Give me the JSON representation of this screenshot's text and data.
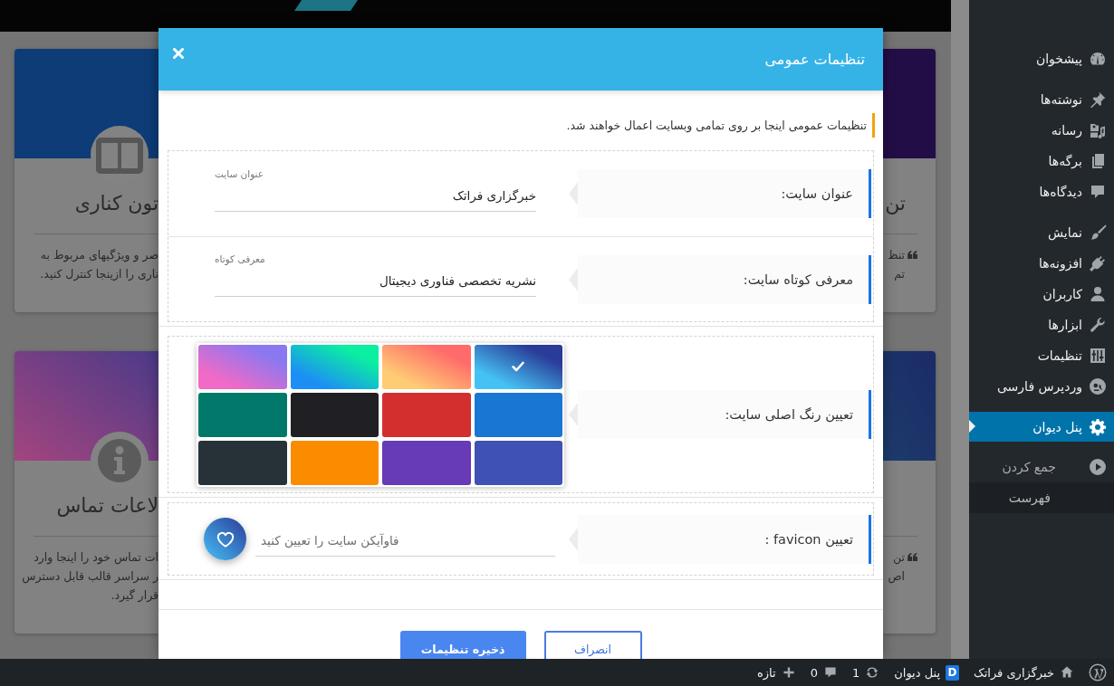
{
  "background_page": {
    "left_cards": [
      {
        "title": "تون کناری",
        "lines": [
          "صر و ویژگیهای مربوط به",
          "ناری را ازینجا کنترل کنید."
        ]
      },
      {
        "title": "لاعات تماس",
        "lines": [
          "ات تماس خود را اینجا وارد",
          "ر سراسر قالب قابل دسترس",
          "قرار گیرد."
        ]
      }
    ],
    "right_cards": [
      {
        "title": "تن",
        "lines": [
          "تنظ",
          "تم"
        ]
      },
      {
        "lines": [
          "تن",
          "اص"
        ]
      }
    ]
  },
  "dialog": {
    "title": "تنظیمات عمومی",
    "notice": "تنظیمات عمومی اینجا بر روی تمامی وبسایت اعمال خواهند شد.",
    "panels": [
      {
        "rows": [
          {
            "kind": "text",
            "label": "عنوان سایت:",
            "field_label": "عنوان سایت",
            "value": "خبرگزاری فراتک"
          },
          {
            "kind": "text",
            "label": "معرفی کوتاه سایت:",
            "field_label": "معرفی کوتاه",
            "value": "نشریه تخصصی فناوری دیجیتال"
          }
        ]
      },
      {
        "rows": [
          {
            "kind": "palette",
            "label": "تعیین رنگ اصلی سایت:",
            "swatches": [
              {
                "kind": "gradient",
                "stops": [
                  {
                    "color": "#2a3b98"
                  },
                  {
                    "color": "#45c2f4"
                  }
                ],
                "selected": true
              },
              {
                "kind": "gradient",
                "stops": [
                  {
                    "color": "#ff6a6a"
                  },
                  {
                    "color": "#ffcb74"
                  }
                ],
                "selected": false
              },
              {
                "kind": "gradient",
                "stops": [
                  {
                    "color": "#0af0a0"
                  },
                  {
                    "color": "#1c8ff5"
                  }
                ],
                "selected": false
              },
              {
                "kind": "gradient",
                "stops": [
                  {
                    "color": "#8a78f0"
                  },
                  {
                    "color": "#f06ac6"
                  }
                ],
                "selected": false
              },
              {
                "kind": "solid",
                "color": "#1976d2",
                "selected": false
              },
              {
                "kind": "solid",
                "color": "#d32f2f",
                "selected": false
              },
              {
                "kind": "solid",
                "color": "#201f23",
                "selected": false
              },
              {
                "kind": "solid",
                "color": "#00796b",
                "selected": false
              },
              {
                "kind": "solid",
                "color": "#3f51b5",
                "selected": false
              },
              {
                "kind": "solid",
                "color": "#673ab7",
                "selected": false
              },
              {
                "kind": "solid",
                "color": "#fb8c00",
                "selected": false
              },
              {
                "kind": "solid",
                "color": "#263238",
                "selected": false
              }
            ]
          }
        ]
      },
      {
        "rows": [
          {
            "kind": "upload",
            "label": "تعیین favicon :",
            "placeholder": "فاوآیکن سایت را تعیین کنید"
          }
        ]
      }
    ],
    "buttons": [
      {
        "kind": "secondary",
        "label": "انصراف"
      },
      {
        "kind": "primary",
        "label": "ذخیره تنظیمات"
      }
    ]
  },
  "sidebar": {
    "sections": [
      {
        "items": [
          {
            "label": "پیشخوان",
            "selected": false
          }
        ]
      },
      {
        "items": [
          {
            "label": "نوشته‌ها",
            "selected": false
          },
          {
            "label": "رسانه",
            "selected": false
          },
          {
            "label": "برگه‌ها",
            "selected": false
          },
          {
            "label": "دیدگاه‌ها",
            "selected": false
          }
        ]
      },
      {
        "items": [
          {
            "label": "نمایش",
            "selected": false
          },
          {
            "label": "افزونه‌ها",
            "selected": false
          },
          {
            "label": "کاربران",
            "selected": false
          },
          {
            "label": "ابزارها",
            "selected": false
          },
          {
            "label": "تنظیمات",
            "selected": false
          },
          {
            "label": "وردپرس فارسی",
            "selected": false
          }
        ]
      },
      {
        "items": [
          {
            "label": "پنل دیوان",
            "selected": true
          }
        ]
      }
    ],
    "collapse_label": "جمع کردن",
    "trailing_text": "فهرست"
  },
  "admin_bar": {
    "site_name": "خبرگزاری فراتک",
    "plugin_badge": "D",
    "plugin_name": "پنل دیوان",
    "updates_count": "1",
    "comments_count": "0",
    "new_label": "تازه"
  }
}
